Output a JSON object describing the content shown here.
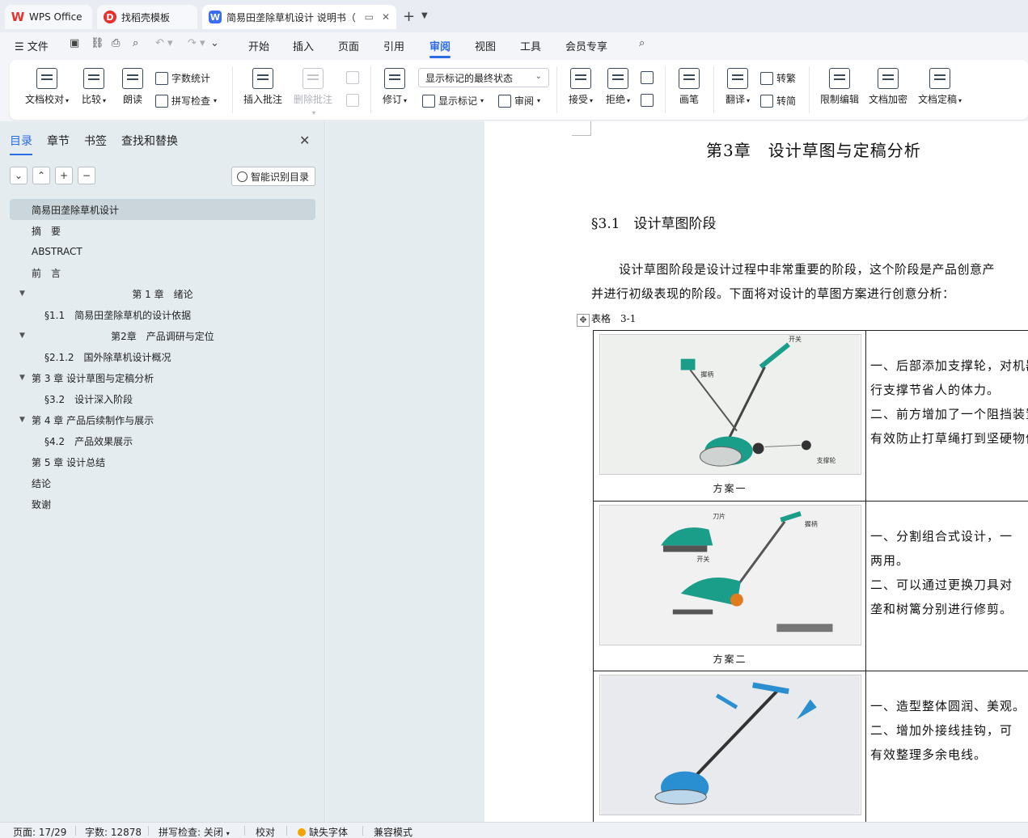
{
  "tabs": {
    "wps": "WPS Office",
    "template": "找稻壳模板",
    "document": "简易田垄除草机设计 说明书（"
  },
  "menu": {
    "file": "文件",
    "items": [
      "开始",
      "插入",
      "页面",
      "引用",
      "审阅",
      "视图",
      "工具",
      "会员专享"
    ],
    "active": "审阅"
  },
  "ribbon": {
    "proofread": "文档校对",
    "compare": "比较",
    "read_aloud": "朗读",
    "word_count": "字数统计",
    "spell_check": "拼写检查",
    "insert_comment": "插入批注",
    "delete_comment": "删除批注",
    "track_changes": "修订",
    "markup_dropdown": "显示标记的最终状态",
    "show_markup": "显示标记",
    "review": "审阅",
    "accept": "接受",
    "reject": "拒绝",
    "ink": "画笔",
    "translate": "翻译",
    "to_traditional": "转繁",
    "to_simplified": "转简",
    "restrict_edit": "限制编辑",
    "encrypt": "文档加密",
    "finalize": "文档定稿"
  },
  "left_panel": {
    "tabs": [
      "目录",
      "章节",
      "书签",
      "查找和替换"
    ],
    "smart_toc": "智能识别目录",
    "toc": [
      {
        "label": "简易田垄除草机设计",
        "level": 0,
        "selected": true
      },
      {
        "label": "摘　要",
        "level": 0
      },
      {
        "label": "ABSTRACT",
        "level": 0
      },
      {
        "label": "前　言",
        "level": 0
      },
      {
        "label": "第 1 章　绪论",
        "level": 0,
        "expanded": true,
        "centered": true
      },
      {
        "label": "§1.1　简易田垄除草机的设计依据",
        "level": 1
      },
      {
        "label": "第2章　产品调研与定位",
        "level": 0,
        "expanded": true,
        "centered": true
      },
      {
        "label": "§2.1.2　国外除草机设计概况",
        "level": 1
      },
      {
        "label": "第 3 章  设计草图与定稿分析",
        "level": 0,
        "expanded": true
      },
      {
        "label": "§3.2　设计深入阶段",
        "level": 1
      },
      {
        "label": "第 4 章  产品后续制作与展示",
        "level": 0,
        "expanded": true
      },
      {
        "label": "§4.2　产品效果展示",
        "level": 1
      },
      {
        "label": "第 5 章  设计总结",
        "level": 0
      },
      {
        "label": "结论",
        "level": 0
      },
      {
        "label": "致谢",
        "level": 0
      }
    ]
  },
  "document": {
    "chapter_title": "第3章　设计草图与定稿分析",
    "section_title": "§3.1　设计草图阶段",
    "para_line1": "设计草图阶段是设计过程中非常重要的阶段，这个阶段是产品创意产",
    "para_line2": "并进行初级表现的阶段。下面将对设计的草图方案进行创意分析：",
    "table_caption": "表格　3-1",
    "rows": [
      {
        "caption": "方案一",
        "lines": [
          "一、后部添加支撑轮，对机器",
          "行支撑节省人的体力。",
          "二、前方增加了一个阻挡装置",
          "有效防止打草绳打到坚硬物体"
        ]
      },
      {
        "caption": "方案二",
        "lines": [
          "一、分割组合式设计，一",
          "两用。",
          "二、可以通过更换刀具对",
          "垄和树篱分别进行修剪。"
        ]
      },
      {
        "caption": "",
        "lines": [
          "一、造型整体圆润、美观。",
          "二、增加外接线挂钩，可",
          "有效整理多余电线。"
        ]
      }
    ],
    "sketch1_labels": [
      "握柄",
      "支撑轮",
      "开关"
    ],
    "sketch2_labels": [
      "刀片",
      "握柄",
      "开关"
    ]
  },
  "status": {
    "page": "页面: 17/29",
    "words": "字数: 12878",
    "spell": "拼写检查: 关闭",
    "proof": "校对",
    "missing_font": "缺失字体",
    "compat": "兼容模式"
  },
  "colors": {
    "accent": "#2b6be6",
    "mower": "#1a9e8a",
    "mower3": "#2a8fd0"
  }
}
